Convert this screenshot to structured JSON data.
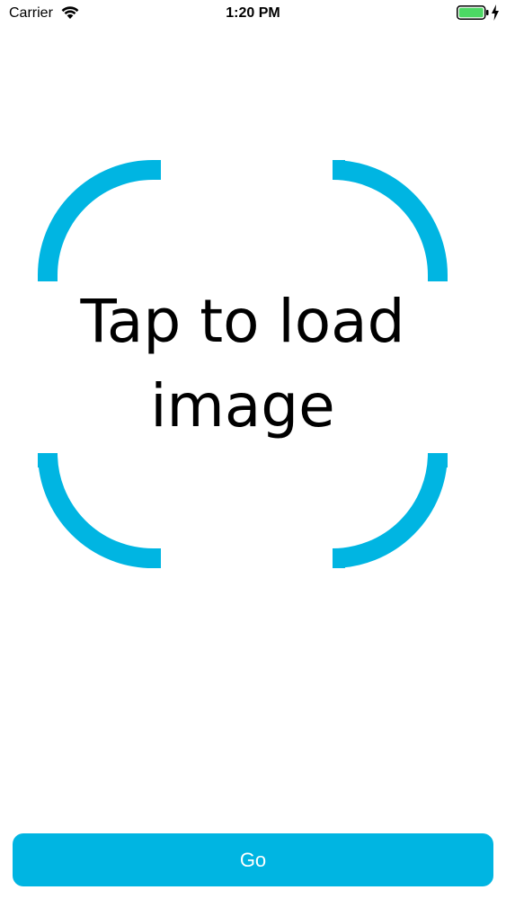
{
  "status_bar": {
    "carrier": "Carrier",
    "time": "1:20 PM",
    "wifi_icon": "wifi-icon",
    "battery_icon": "battery-full-icon",
    "charging_icon": "charging-bolt-icon",
    "battery_color": "#4cd964"
  },
  "load_area": {
    "prompt": "Tap to load image",
    "frame_color": "#00b5e2"
  },
  "actions": {
    "go_label": "Go",
    "button_color": "#00b5e2"
  }
}
